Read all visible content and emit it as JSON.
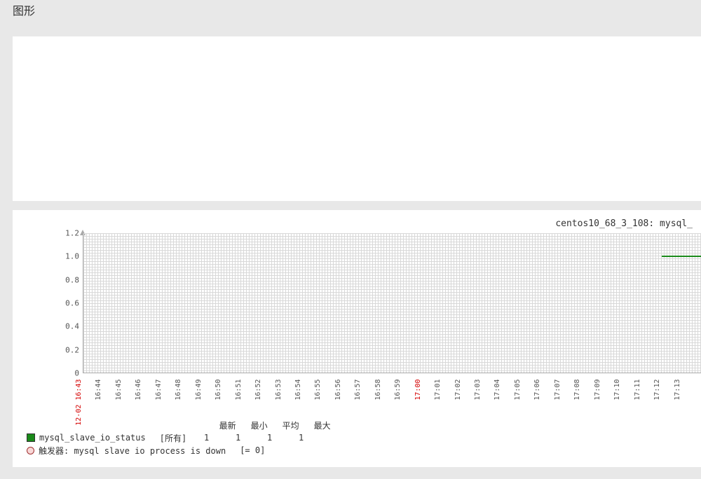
{
  "page_title": "图形",
  "chart_header": "centos10_68_3_108: mysql_",
  "chart_data": {
    "type": "line",
    "title": "centos10_68_3_108: mysql_",
    "xlabel": "",
    "ylabel": "",
    "ylim": [
      0,
      1.2
    ],
    "y_ticks": [
      "0",
      "0.2",
      "0.4",
      "0.6",
      "0.8",
      "1.0",
      "1.2"
    ],
    "x_ticks": [
      {
        "label": "12-02 16:43",
        "red": true
      },
      {
        "label": "16:44",
        "red": false
      },
      {
        "label": "16:45",
        "red": false
      },
      {
        "label": "16:46",
        "red": false
      },
      {
        "label": "16:47",
        "red": false
      },
      {
        "label": "16:48",
        "red": false
      },
      {
        "label": "16:49",
        "red": false
      },
      {
        "label": "16:50",
        "red": false
      },
      {
        "label": "16:51",
        "red": false
      },
      {
        "label": "16:52",
        "red": false
      },
      {
        "label": "16:53",
        "red": false
      },
      {
        "label": "16:54",
        "red": false
      },
      {
        "label": "16:55",
        "red": false
      },
      {
        "label": "16:56",
        "red": false
      },
      {
        "label": "16:57",
        "red": false
      },
      {
        "label": "16:58",
        "red": false
      },
      {
        "label": "16:59",
        "red": false
      },
      {
        "label": "17:00",
        "red": true
      },
      {
        "label": "17:01",
        "red": false
      },
      {
        "label": "17:02",
        "red": false
      },
      {
        "label": "17:03",
        "red": false
      },
      {
        "label": "17:04",
        "red": false
      },
      {
        "label": "17:05",
        "red": false
      },
      {
        "label": "17:06",
        "red": false
      },
      {
        "label": "17:07",
        "red": false
      },
      {
        "label": "17:08",
        "red": false
      },
      {
        "label": "17:09",
        "red": false
      },
      {
        "label": "17:10",
        "red": false
      },
      {
        "label": "17:11",
        "red": false
      },
      {
        "label": "17:12",
        "red": false
      },
      {
        "label": "17:13",
        "red": false
      }
    ],
    "series": [
      {
        "name": "mysql_slave_io_status",
        "color": "#1a8a1a",
        "data_start_tick": 29,
        "value": 1.0
      }
    ]
  },
  "legend": {
    "metric_name": "mysql_slave_io_status",
    "mode": "[所有]",
    "stat_headers": [
      "最新",
      "最小",
      "平均",
      "最大"
    ],
    "stat_values": [
      "1",
      "1",
      "1",
      "1"
    ],
    "trigger_label": "触发器: mysql slave io process is down",
    "trigger_cond": "[= 0]"
  }
}
